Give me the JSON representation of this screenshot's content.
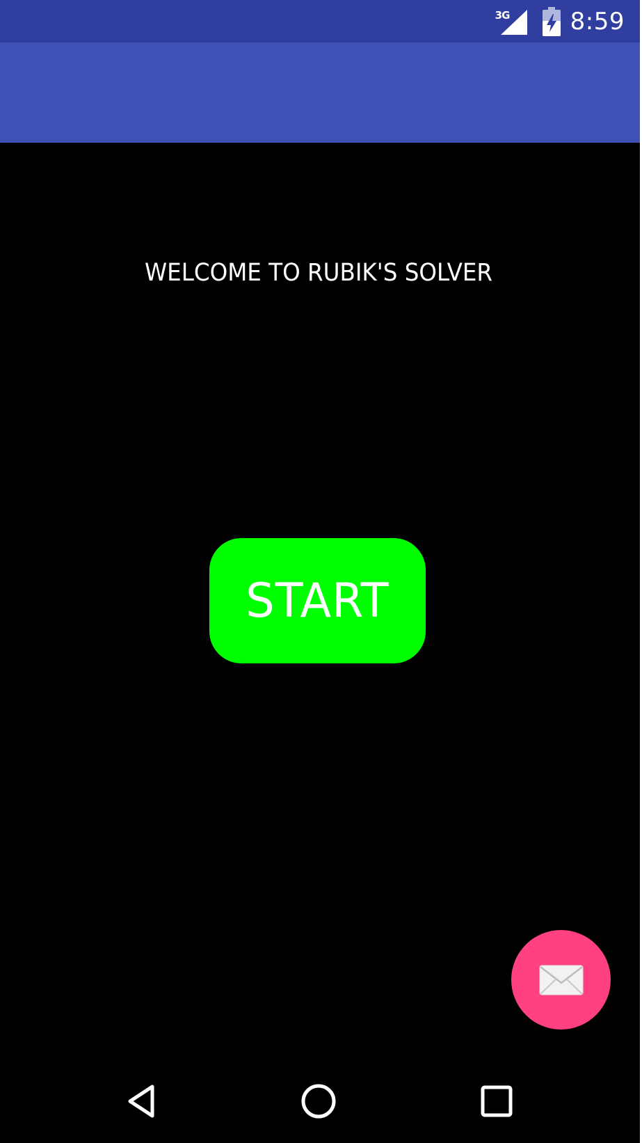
{
  "status_bar": {
    "network_type": "3G",
    "time": "8:59",
    "icons": [
      "signal-icon",
      "battery-charging-icon"
    ],
    "background_color": "#303f9f"
  },
  "app_bar": {
    "background_color": "#3f51b5"
  },
  "main": {
    "welcome_text": "WELCOME TO RUBIK'S SOLVER",
    "start_button_label": "START",
    "start_button_color": "#00ff00",
    "background_color": "#000000"
  },
  "fab": {
    "icon": "mail-icon",
    "color": "#ff4081"
  },
  "nav_bar": {
    "icons": [
      "back-icon",
      "home-icon",
      "recents-icon"
    ]
  }
}
